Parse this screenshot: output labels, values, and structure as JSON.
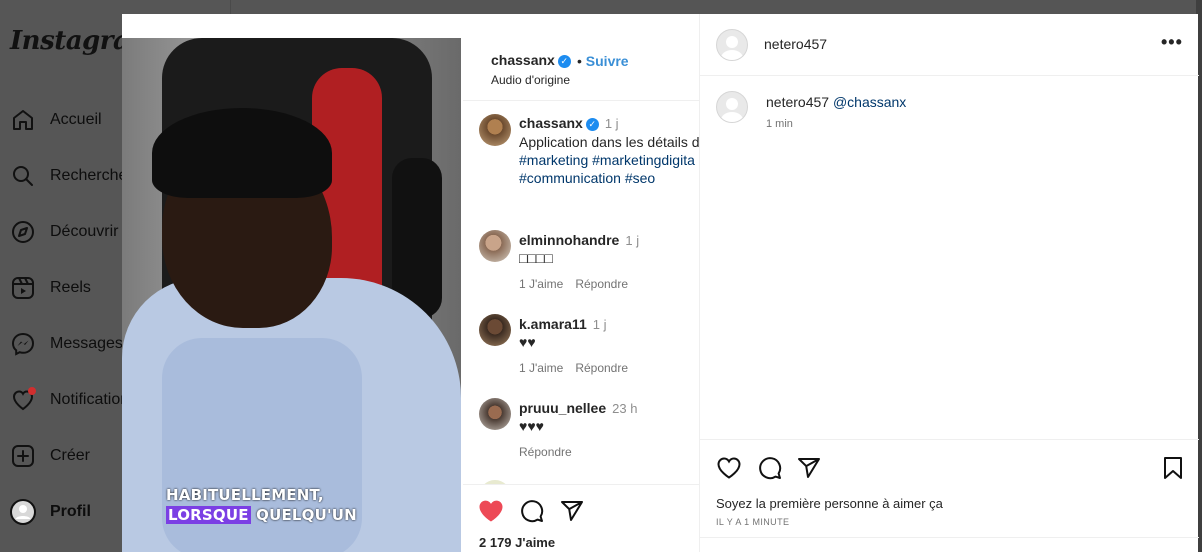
{
  "sidebar": {
    "logo": "Instagram",
    "items": [
      {
        "label": "Accueil",
        "icon": "home-icon"
      },
      {
        "label": "Recherche",
        "icon": "search-icon"
      },
      {
        "label": "Découvrir",
        "icon": "compass-icon"
      },
      {
        "label": "Reels",
        "icon": "reels-icon"
      },
      {
        "label": "Messages",
        "icon": "messenger-icon"
      },
      {
        "label": "Notifications",
        "icon": "heart-icon"
      },
      {
        "label": "Créer",
        "icon": "plus-square-icon"
      },
      {
        "label": "Profil",
        "icon": "avatar-icon"
      }
    ]
  },
  "video": {
    "caption_line1": "HABITUELLEMENT,",
    "caption_line2_highlight": "LORSQUE",
    "caption_line2_rest": " QUELQU'UN"
  },
  "post": {
    "username": "chassanx",
    "follow_label": "Suivre",
    "audio": "Audio d'origine",
    "caption_user": "chassanx",
    "caption_time": "1 j",
    "caption_text": "Application dans les détails d",
    "caption_tags_1": "#marketing #marketingdigita",
    "caption_tags_2": "#communication #seo",
    "comments": [
      {
        "user": "elminnohandre",
        "time": "1 j",
        "text": "□□□□",
        "likes": "1 J'aime",
        "reply": "Répondre"
      },
      {
        "user": "k.amara11",
        "time": "1 j",
        "text": "♥♥",
        "likes": "1 J'aime",
        "reply": "Répondre"
      },
      {
        "user": "pruuu_nellee",
        "time": "23 h",
        "text": "♥♥♥",
        "likes": "",
        "reply": "Répondre"
      }
    ],
    "likes_count": "2 179 J'aime",
    "heart_color": "#ed4956"
  },
  "right_panel": {
    "username": "netero457",
    "comment_user": "netero457",
    "comment_mention": "@chassanx",
    "comment_time": "1 min",
    "likes_text": "Soyez la première personne à aimer ça",
    "time_ago": "IL Y A 1 MINUTE"
  }
}
